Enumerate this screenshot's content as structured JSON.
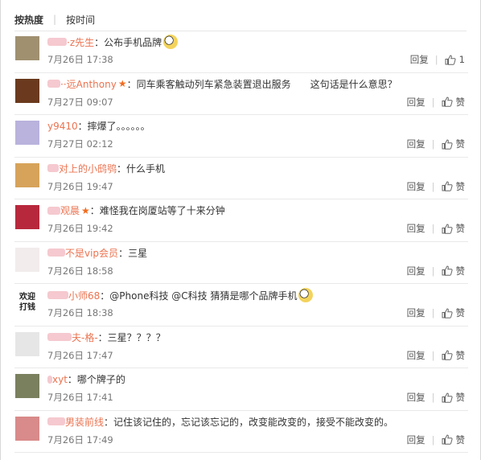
{
  "tabs": [
    {
      "label": "按热度",
      "active": true
    },
    {
      "label": "按时间",
      "active": false
    }
  ],
  "comments": [
    {
      "name": "·z先生",
      "vip": false,
      "text": "：公布手机品牌",
      "time": "7月26日 17:38",
      "reply": "回复",
      "like_label": "1",
      "emoji": true,
      "avatar_color": "#a09070",
      "blur_w": 24
    },
    {
      "name": "··远Anthony",
      "vip": true,
      "text": "：同车乘客触动列车紧急装置退出服务　　这句话是什么意思？",
      "time": "7月27日 09:07",
      "reply": "回复",
      "like_label": "赞",
      "emoji": false,
      "avatar_color": "#6b3a1e",
      "blur_w": 16
    },
    {
      "name": "y9410",
      "vip": false,
      "text": "：摔爆了。。。。。。",
      "time": "7月27日 02:12",
      "reply": "回复",
      "like_label": "赞",
      "emoji": false,
      "avatar_color": "#b9b3dd",
      "blur_w": 0
    },
    {
      "name": "对上的小鸱鸮",
      "vip": false,
      "text": "：什么手机",
      "time": "7月26日 19:47",
      "reply": "回复",
      "like_label": "赞",
      "emoji": false,
      "avatar_color": "#d7a35a",
      "blur_w": 14
    },
    {
      "name": "观晨",
      "vip": true,
      "text": "：难怪我在岗厦站等了十来分钟",
      "time": "7月26日 19:42",
      "reply": "回复",
      "like_label": "赞",
      "emoji": false,
      "avatar_color": "#b8283c",
      "blur_w": 16
    },
    {
      "name": "不是vip会员",
      "vip": false,
      "text": "：三星",
      "time": "7月26日 18:58",
      "reply": "回复",
      "like_label": "赞",
      "emoji": false,
      "avatar_color": "#f2ecec",
      "blur_w": 22
    },
    {
      "name": "小师68",
      "vip": false,
      "text": "：@Phone科技 @C科技 猜猜是哪个品牌手机",
      "time": "7月26日 18:38",
      "reply": "回复",
      "like_label": "赞",
      "emoji": true,
      "avatar_text": "欢迎\n打钱",
      "avatar_color": "#ffffff",
      "blur_w": 26
    },
    {
      "name": "夫-格-",
      "vip": false,
      "text": "：三星？？？？",
      "time": "7月26日 17:47",
      "reply": "回复",
      "like_label": "赞",
      "emoji": false,
      "avatar_color": "#e6e6e6",
      "blur_w": 30
    },
    {
      "name": "xyt",
      "vip": false,
      "text": "：哪个牌子的",
      "time": "7月26日 17:41",
      "reply": "回复",
      "like_label": "赞",
      "emoji": false,
      "avatar_color": "#7a7f5e",
      "blur_w": 6
    },
    {
      "name": "男装前线",
      "vip": false,
      "text": "：记住该记住的，忘记该忘记的，改变能改变的，接受不能改变的。",
      "time": "7月26日 17:49",
      "reply": "回复",
      "like_label": "赞",
      "emoji": false,
      "avatar_color": "#d98a8a",
      "blur_w": 22
    }
  ]
}
